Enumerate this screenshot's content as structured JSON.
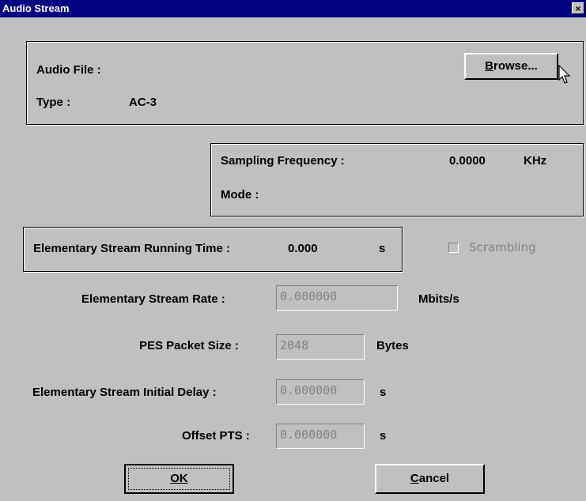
{
  "window": {
    "title": "Audio Stream",
    "close_glyph": "×"
  },
  "file_group": {
    "audio_file_label": "Audio File :",
    "type_label": "Type :",
    "type_value": "AC-3",
    "browse_label": "Browse...",
    "browse_mnemonic": "B"
  },
  "sampling": {
    "freq_label": "Sampling Frequency :",
    "freq_value": "0.0000",
    "freq_unit": "KHz",
    "mode_label": "Mode :"
  },
  "running_time": {
    "label": "Elementary Stream Running Time :",
    "value": "0.000",
    "unit": "s"
  },
  "scrambling": {
    "label": "Scrambling",
    "checked": false
  },
  "fields": {
    "es_rate_label": "Elementary Stream Rate :",
    "es_rate_value": "0.000000",
    "es_rate_unit": "Mbits/s",
    "pes_label": "PES Packet Size :",
    "pes_value": "2048",
    "pes_unit": "Bytes",
    "delay_label": "Elementary Stream Initial Delay :",
    "delay_value": "0.000000",
    "delay_unit": "s",
    "offset_label": "Offset PTS :",
    "offset_value": "0.000000",
    "offset_unit": "s"
  },
  "buttons": {
    "ok_label": "OK",
    "cancel_label": "Cancel"
  }
}
